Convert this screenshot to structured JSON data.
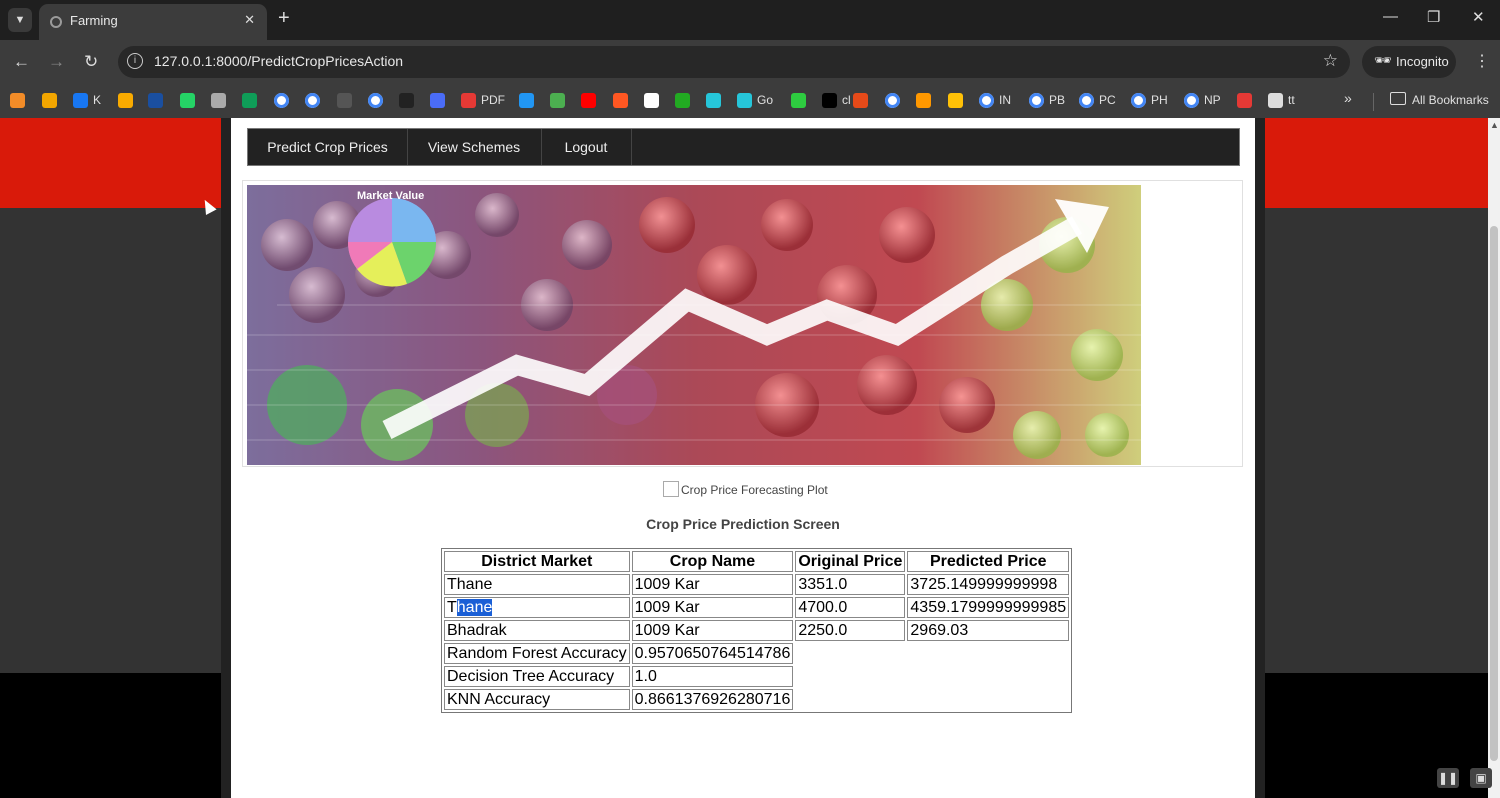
{
  "browser": {
    "tab_title": "Farming",
    "url": "127.0.0.1:8000/PredictCropPricesAction",
    "incognito_label": "Incognito",
    "all_bookmarks_label": "All Bookmarks",
    "bookmarks": [
      {
        "label": "",
        "color": "#f28c28"
      },
      {
        "label": "",
        "color": "#f2a600"
      },
      {
        "label": "K",
        "color": "#1877f2"
      },
      {
        "label": "",
        "color": "#f9ab00"
      },
      {
        "label": "",
        "color": "#1a4fa0"
      },
      {
        "label": "",
        "color": "#25d366"
      },
      {
        "label": "",
        "color": "#aaaaaa"
      },
      {
        "label": "",
        "color": "#0f9d58"
      },
      {
        "label": "",
        "color": "google"
      },
      {
        "label": "",
        "color": "google"
      },
      {
        "label": "",
        "color": "#555555"
      },
      {
        "label": "",
        "color": "google"
      },
      {
        "label": "",
        "color": "#222222"
      },
      {
        "label": "",
        "color": "#4a6cf7"
      },
      {
        "label": "PDF",
        "color": "#e53935"
      },
      {
        "label": "",
        "color": "#2196f3"
      },
      {
        "label": "",
        "color": "#4caf50"
      },
      {
        "label": "",
        "color": "#ff0000"
      },
      {
        "label": "",
        "color": "#ff5722"
      },
      {
        "label": "",
        "color": "#ffffff"
      },
      {
        "label": "",
        "color": "#22aa22"
      },
      {
        "label": "",
        "color": "#26c6da"
      },
      {
        "label": "Go",
        "color": "#26c6da"
      },
      {
        "label": "",
        "color": "#2ecc40"
      },
      {
        "label": "cl",
        "color": "#000000"
      },
      {
        "label": "",
        "color": "#e64a19"
      },
      {
        "label": "",
        "color": "google"
      },
      {
        "label": "",
        "color": "#ff9800"
      },
      {
        "label": "",
        "color": "#ffc107"
      },
      {
        "label": "IN",
        "color": "google"
      },
      {
        "label": "PB",
        "color": "google"
      },
      {
        "label": "PC",
        "color": "google"
      },
      {
        "label": "PH",
        "color": "google"
      },
      {
        "label": "NP",
        "color": "google"
      },
      {
        "label": "",
        "color": "#e53935"
      },
      {
        "label": "tt",
        "color": "#dddddd"
      }
    ]
  },
  "nav": {
    "items": [
      "Predict Crop Prices",
      "View Schemes",
      "Logout"
    ]
  },
  "banner": {
    "caption": "Market Value"
  },
  "plot": {
    "alt_text": "Crop Price Forecasting Plot"
  },
  "screen_title": "Crop Price Prediction Screen",
  "table": {
    "headers": [
      "District Market",
      "Crop Name",
      "Original Price",
      "Predicted Price"
    ],
    "rows": [
      [
        "Thane",
        "1009 Kar",
        "3351.0",
        "3725.149999999998"
      ],
      [
        "Thane",
        "1009 Kar",
        "4700.0",
        "4359.1799999999985"
      ],
      [
        "Bhadrak",
        "1009 Kar",
        "2250.0",
        "2969.03"
      ]
    ],
    "accuracy": [
      [
        "Random Forest Accuracy",
        "0.9570650764514786"
      ],
      [
        "Decision Tree Accuracy",
        "1.0"
      ],
      [
        "KNN Accuracy",
        "0.8661376926280716"
      ]
    ]
  },
  "colors": {
    "red_band": "#d91a0a",
    "menu_bg": "#222222",
    "selection": "#1a5fd6"
  }
}
